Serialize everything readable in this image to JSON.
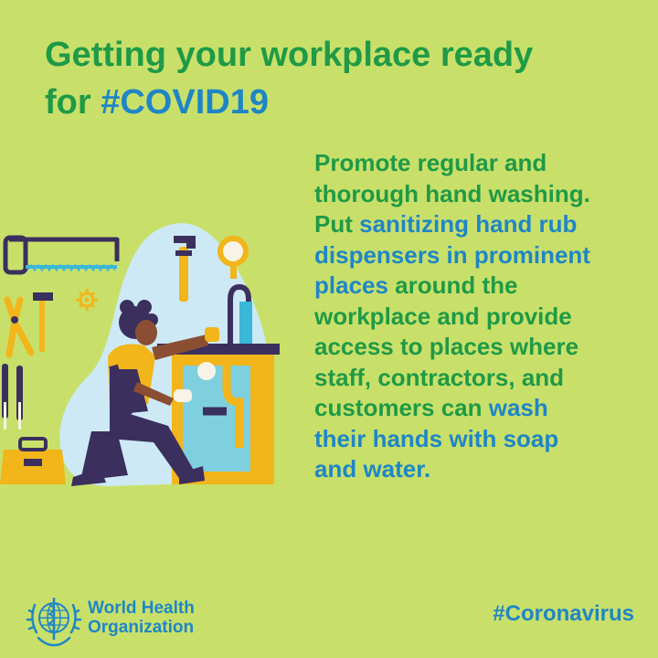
{
  "title": {
    "line1": "Getting your workplace ready",
    "line2_prefix": "for ",
    "line2_hashtag": "#COVID19"
  },
  "body": {
    "seg1": "Promote regular and\nthorough hand washing.\nPut ",
    "seg2": "sanitizing hand rub\ndispensers in prominent\nplaces",
    "seg3": " around the\nworkplace and provide\naccess to places where\nstaff, contractors, and\ncustomers can ",
    "seg4": "wash\ntheir hands with soap\nand water."
  },
  "illustration": {
    "icon": "plumber-fixing-sink-illustration"
  },
  "footer": {
    "org_line1": "World Health",
    "org_line2": "Organization",
    "logo_icon": "who-emblem-icon",
    "hashtag": "#Coronavirus"
  },
  "colors": {
    "background": "#c8e06a",
    "green": "#1f9a46",
    "blue": "#1f86c6",
    "yellow": "#f2b51a",
    "navy": "#3b2f5e"
  }
}
